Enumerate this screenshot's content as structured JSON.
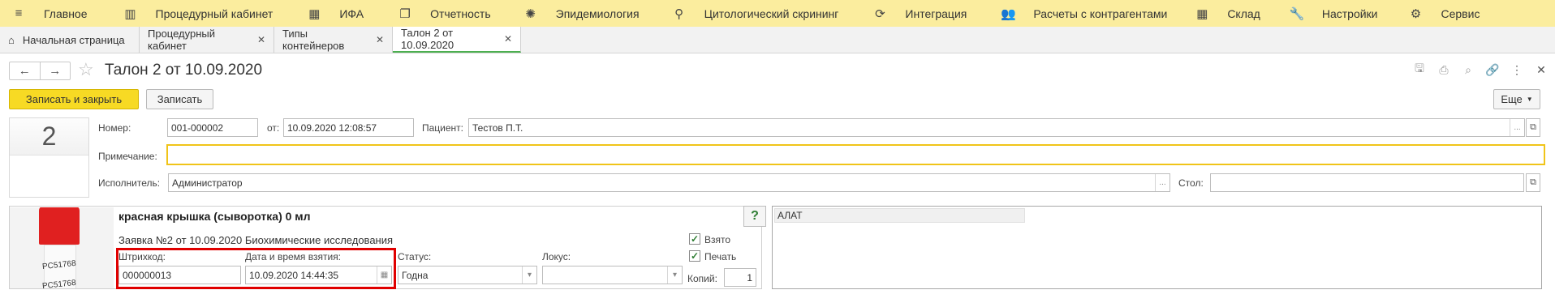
{
  "top_menu": [
    {
      "label": "Главное",
      "icon": "hamburger-icon"
    },
    {
      "label": "Процедурный кабинет",
      "icon": "tube-rack-icon"
    },
    {
      "label": "ИФА",
      "icon": "grid-icon"
    },
    {
      "label": "Отчетность",
      "icon": "documents-icon"
    },
    {
      "label": "Эпидемиология",
      "icon": "virus-icon"
    },
    {
      "label": "Цитологический скрининг",
      "icon": "microscope-icon"
    },
    {
      "label": "Интеграция",
      "icon": "sync-icon"
    },
    {
      "label": "Расчеты с контрагентами",
      "icon": "people-icon"
    },
    {
      "label": "Склад",
      "icon": "warehouse-icon"
    },
    {
      "label": "Настройки",
      "icon": "wrench-icon"
    },
    {
      "label": "Сервис",
      "icon": "gear-icon"
    }
  ],
  "tabs": [
    {
      "label": "Начальная страница",
      "closable": false
    },
    {
      "label": "Процедурный кабинет",
      "closable": true
    },
    {
      "label": "Типы контейнеров",
      "closable": true
    },
    {
      "label": "Талон 2 от 10.09.2020",
      "closable": true,
      "active": true
    }
  ],
  "header": {
    "title": "Талон 2 от 10.09.2020",
    "back": "←",
    "forward": "→",
    "star": "☆",
    "icons": [
      "save-icon",
      "print-icon",
      "preview-icon",
      "link-icon",
      "more-icon",
      "close-icon"
    ]
  },
  "toolbar": {
    "save_close": "Записать и закрыть",
    "save": "Записать",
    "more": "Еще"
  },
  "form": {
    "big_number": "2",
    "number_label": "Номер:",
    "number_value": "001-000002",
    "date_label": "от:",
    "date_value": "10.09.2020 12:08:57",
    "patient_label": "Пациент:",
    "patient_value": "Тестов П.Т.",
    "note_label": "Примечание:",
    "note_value": "",
    "executor_label": "Исполнитель:",
    "executor_value": "Администратор",
    "table_label": "Стол:",
    "table_value": ""
  },
  "container": {
    "title": "красная крышка (сыворотка) 0 мл",
    "request": "Заявка №2 от 10.09.2020 Биохимические исследования",
    "tube_code": "PC51768",
    "barcode_label": "Штрихкод:",
    "barcode_value": "000000013",
    "datetime_label": "Дата и время взятия:",
    "datetime_value": "10.09.2020 14:44:35",
    "status_label": "Статус:",
    "status_value": "Годна",
    "locus_label": "Локус:",
    "locus_value": "",
    "taken_label": "Взято",
    "print_label": "Печать",
    "copies_label": "Копий:",
    "copies_value": "1",
    "help": "?",
    "tests": [
      "АЛАТ"
    ]
  },
  "colors": {
    "menu_bg": "#fbed9e",
    "primary_button": "#f7da24",
    "active_tab_underline": "#4caf50",
    "highlight_frame": "#e00000",
    "focus_border": "#f0c419"
  }
}
